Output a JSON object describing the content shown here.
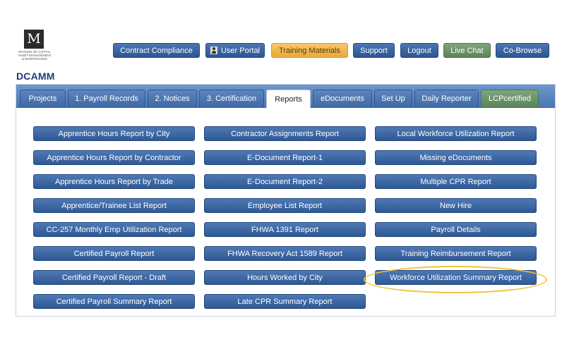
{
  "logo": {
    "mark": "M",
    "org_text": "Division of Capital Asset Management & Maintenance",
    "brand": "DCAMM"
  },
  "topnav": [
    {
      "label": "Contract Compliance",
      "style": "blue"
    },
    {
      "label": "User Portal",
      "style": "blue",
      "icon": "user-icon"
    },
    {
      "label": "Training Materials",
      "style": "orange"
    },
    {
      "label": "Support",
      "style": "blue"
    },
    {
      "label": "Logout",
      "style": "blue"
    },
    {
      "label": "Live Chat",
      "style": "green"
    },
    {
      "label": "Co-Browse",
      "style": "blue"
    }
  ],
  "tabs": [
    {
      "label": "Projects"
    },
    {
      "label": "1. Payroll Records"
    },
    {
      "label": "2. Notices"
    },
    {
      "label": "3. Certification"
    },
    {
      "label": "Reports",
      "active": true
    },
    {
      "label": "eDocuments"
    },
    {
      "label": "Set Up"
    },
    {
      "label": "Daily Reporter"
    },
    {
      "label": "LCPcertified",
      "style": "green"
    }
  ],
  "reports": {
    "col1": [
      "Apprentice Hours Report by City",
      "Apprentice Hours Report by Contractor",
      "Apprentice Hours Report by Trade",
      "Apprentice/Trainee List Report",
      "CC-257 Monthly Emp Utilization Report",
      "Certified Payroll Report",
      "Certified Payroll Report - Draft",
      "Certified Payroll Summary Report"
    ],
    "col2": [
      "Contractor Assignments Report",
      "E-Document Report-1",
      "E-Document Report-2",
      "Employee List Report",
      "FHWA 1391 Report",
      "FHWA Recovery Act 1589 Report",
      "Hours Worked by City",
      "Late CPR Summary Report"
    ],
    "col3": [
      "Local Workforce Utilization Report",
      "Missing eDocuments",
      "Multiple CPR Report",
      "New Hire",
      "Payroll Details",
      "Training Reimbursement Report",
      "Workforce Utilization Summary Report"
    ]
  },
  "colors": {
    "button_blue": "#2e5994",
    "tab_bar": "#4a78b5",
    "orange": "#e9a93a",
    "green": "#5b8459",
    "highlight_ring": "#f0c23d"
  }
}
